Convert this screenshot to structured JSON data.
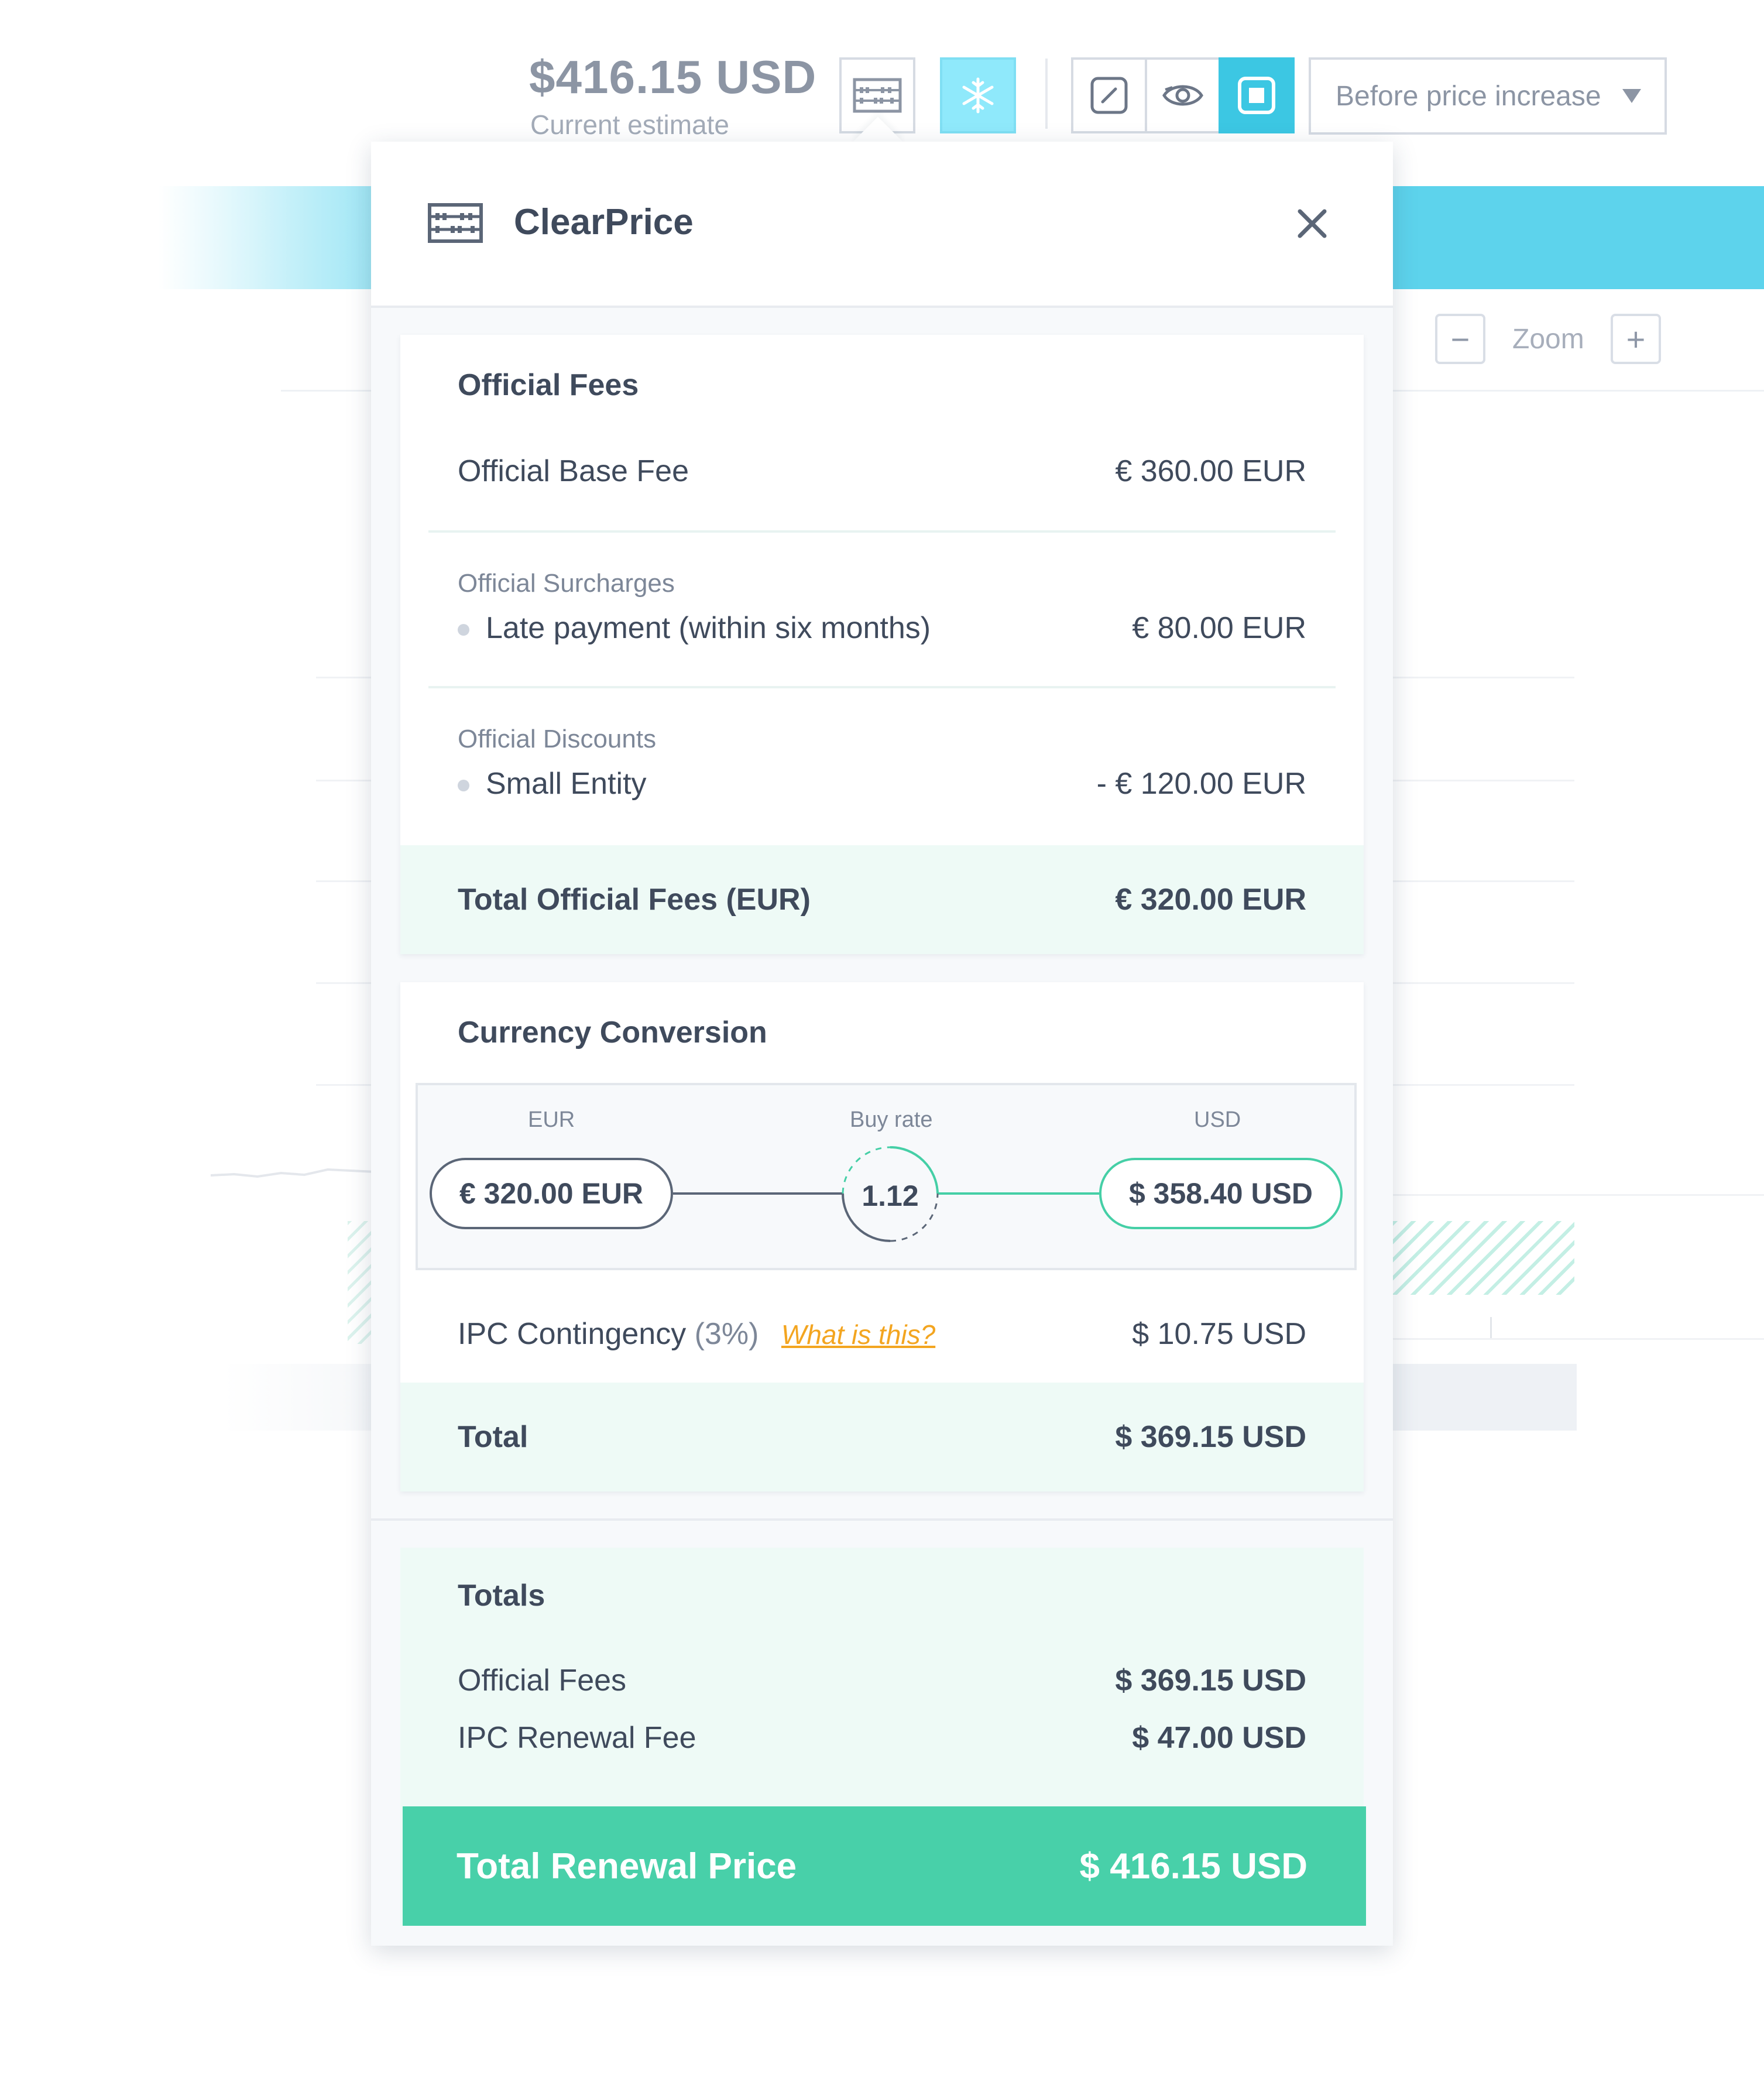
{
  "estimate": {
    "price": "$416.15 USD",
    "label": "Current estimate"
  },
  "toolbar": {
    "calculator_icon": "abacus-icon",
    "freeze_icon": "snowflake-icon",
    "edit_icon": "edit-icon",
    "view_icon": "eye-icon",
    "fit_icon": "fit-screen-icon",
    "dropdown_value": "Before price increase",
    "active_color": "#8fe9fb",
    "selected_color": "#3cc7e3"
  },
  "zoom": {
    "label": "Zoom",
    "minus": "−",
    "plus": "+"
  },
  "popover": {
    "title": "ClearPrice",
    "official_fees": {
      "title": "Official Fees",
      "base_fee_label": "Official Base Fee",
      "base_fee_value": "€ 360.00 EUR",
      "surcharges_heading": "Official Surcharges",
      "surcharge_label": "Late payment (within six months)",
      "surcharge_value": "€ 80.00 EUR",
      "discounts_heading": "Official Discounts",
      "discount_label": "Small Entity",
      "discount_value": "- € 120.00 EUR",
      "total_label": "Total Official Fees (EUR)",
      "total_value": "€ 320.00 EUR"
    },
    "conversion": {
      "title": "Currency Conversion",
      "from_heading": "EUR",
      "rate_heading": "Buy rate",
      "to_heading": "USD",
      "from_value": "€ 320.00 EUR",
      "rate_value": "1.12",
      "to_value": "$ 358.40 USD",
      "contingency_label": "IPC Contingency",
      "contingency_pct": "(3%)",
      "contingency_link": "What is this?",
      "contingency_value": "$ 10.75 USD",
      "total_label": "Total",
      "total_value": "$ 369.15 USD"
    },
    "totals": {
      "title": "Totals",
      "official_label": "Official Fees",
      "official_value": "$ 369.15 USD",
      "ipc_label": "IPC Renewal Fee",
      "ipc_value": "$ 47.00 USD",
      "grand_label": "Total Renewal Price",
      "grand_value": "$ 416.15 USD",
      "accent_color": "#48d0a9"
    }
  }
}
